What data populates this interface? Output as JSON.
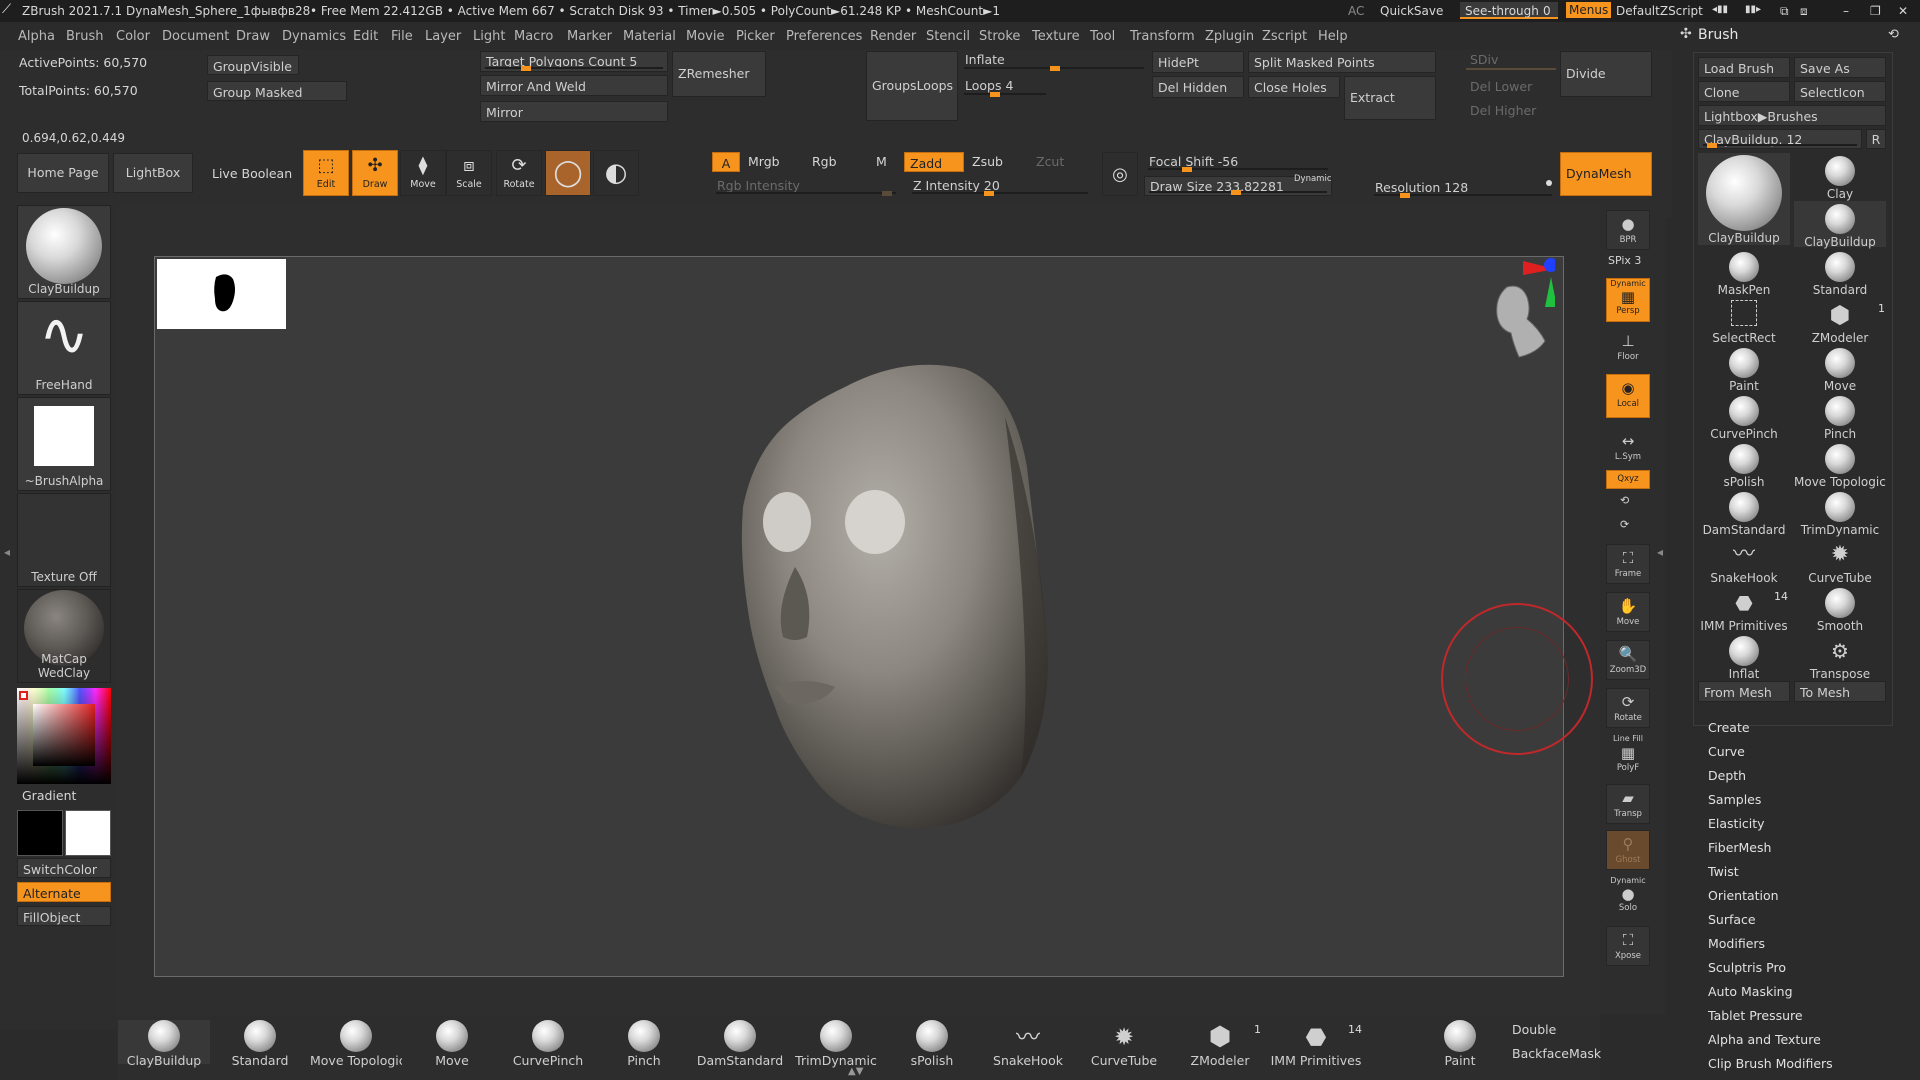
{
  "titlebar": {
    "app": "ZBrush 2021.7.1",
    "doc": "DynaMesh_Sphere_1фывфв28",
    "stats": "• Free Mem 22.412GB • Active Mem 667 • Scratch Disk 93 • Timer►0.505 • PolyCount►61.248 KP • MeshCount►1",
    "ac": "AC",
    "quicksave": "QuickSave",
    "seethrough": "See-through",
    "seethrough_val": "0",
    "menus": "Menus",
    "script": "DefaultZScript"
  },
  "menubar": [
    "Alpha",
    "Brush",
    "Color",
    "Document",
    "Draw",
    "Dynamics",
    "Edit",
    "File",
    "Layer",
    "Light",
    "Macro",
    "Marker",
    "Material",
    "Movie",
    "Picker",
    "Preferences",
    "Render",
    "Stencil",
    "Stroke",
    "Texture",
    "Tool",
    "Transform",
    "Zplugin",
    "Zscript",
    "Help"
  ],
  "info": {
    "active_points": "ActivePoints: 60,570",
    "total_points": "TotalPoints: 60,570",
    "coords": "0.694,0.62,0.449"
  },
  "topshelf": {
    "group_visible": "GroupVisible",
    "group_masked": "Group Masked",
    "target_poly": "Target Polygons Count 5",
    "mirror_weld": "Mirror And Weld",
    "mirror": "Mirror",
    "zremesher": "ZRemesher",
    "groupsloops": "GroupsLoops",
    "inflate": "Inflate",
    "loops": "Loops 4",
    "hidept": "HidePt",
    "del_hidden": "Del Hidden",
    "split_masked": "Split Masked Points",
    "close_holes": "Close Holes",
    "extract": "Extract",
    "sdiv": "SDiv",
    "del_lower": "Del Lower",
    "del_higher": "Del Higher",
    "divide": "Divide",
    "home_page": "Home Page",
    "lightbox": "LightBox",
    "live_boolean": "Live Boolean",
    "edit": "Edit",
    "draw": "Draw",
    "move": "Move",
    "scale": "Scale",
    "rotate": "Rotate",
    "a": "A",
    "mrgb": "Mrgb",
    "rgb": "Rgb",
    "m": "M",
    "zadd": "Zadd",
    "zsub": "Zsub",
    "zcut": "Zcut",
    "rgb_intensity": "Rgb Intensity",
    "z_intensity": "Z Intensity 20",
    "focal_shift": "Focal Shift -56",
    "draw_size": "Draw Size 233.82281",
    "dynamic": "Dynamic",
    "resolution": "Resolution 128",
    "dynamesh": "DynaMesh"
  },
  "left": {
    "brush": "ClayBuildup",
    "stroke": "FreeHand",
    "alpha": "~BrushAlpha",
    "texture": "Texture Off",
    "material": "MatCap WedClay",
    "gradient": "Gradient",
    "switchcolor": "SwitchColor",
    "alternate": "Alternate",
    "fillobject": "FillObject"
  },
  "right": {
    "bpr": "BPR",
    "spix": "SPix 3",
    "persp_top": "Dynamic",
    "persp": "Persp",
    "floor": "Floor",
    "local": "Local",
    "lsym": "L.Sym",
    "xyz": "Qxyz",
    "frame": "Frame",
    "move": "Move",
    "zoom": "Zoom3D",
    "rotate": "Rotate",
    "linefill_top": "Line Fill",
    "polyf": "PolyF",
    "transp": "Transp",
    "ghost": "Ghost",
    "solo_top": "Dynamic",
    "solo": "Solo",
    "xpose": "Xpose"
  },
  "brushpanel": {
    "title": "Brush",
    "load": "Load Brush",
    "save": "Save As",
    "clone": "Clone",
    "selecticon": "SelectIcon",
    "lightbox_brushes": "Lightbox▶Brushes",
    "current": "ClayBuildup. 12",
    "r": "R",
    "cells": [
      "Clay",
      "ClayBuildup",
      "MaskPen",
      "Standard",
      "SelectRect",
      "ZModeler",
      "Paint",
      "Move",
      "CurvePinch",
      "Pinch",
      "sPolish",
      "Move Topologica",
      "DamStandard",
      "TrimDynamic",
      "SnakeHook",
      "CurveTube",
      "IMM Primitives",
      "Smooth",
      "Inflat",
      "Transpose"
    ],
    "big": "ClayBuildup",
    "zmodeler_count": "1",
    "imm_count": "14",
    "from_mesh": "From Mesh",
    "to_mesh": "To Mesh",
    "subpalettes": [
      "Create",
      "Curve",
      "Depth",
      "Samples",
      "Elasticity",
      "FiberMesh",
      "Twist",
      "Orientation",
      "Surface",
      "Modifiers",
      "Sculptris Pro",
      "Auto Masking",
      "Tablet Pressure",
      "Alpha and Texture",
      "Clip Brush Modifiers"
    ]
  },
  "bottom": {
    "brushes": [
      "ClayBuildup",
      "Standard",
      "Move Topologica",
      "Move",
      "CurvePinch",
      "Pinch",
      "DamStandard",
      "TrimDynamic",
      "sPolish",
      "SnakeHook",
      "CurveTube",
      "ZModeler",
      "IMM Primitives",
      "Paint"
    ],
    "zmodeler_count": "1",
    "imm_count": "14",
    "double": "Double",
    "backface": "BackfaceMask"
  },
  "colors": {
    "accent": "#f7941d",
    "bg": "#2b2b2b",
    "canvas": "#3b3b3b",
    "cursor": "#c0282a"
  }
}
